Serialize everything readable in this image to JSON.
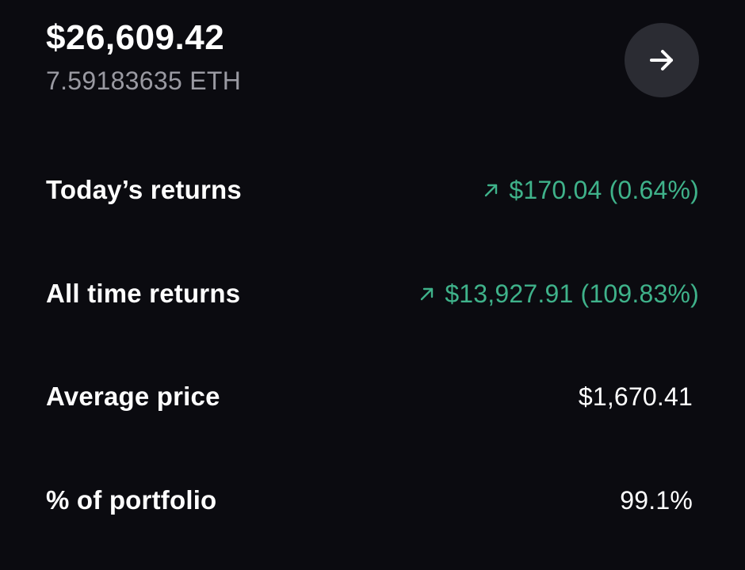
{
  "header": {
    "balance_usd": "$26,609.42",
    "balance_crypto": "7.59183635 ETH",
    "forward_icon": "arrow-right-icon"
  },
  "stats": {
    "today_returns": {
      "label": "Today’s returns",
      "value": "$170.04 (0.64%)",
      "icon": "arrow-up-right-icon"
    },
    "all_time_returns": {
      "label": "All time returns",
      "value": "$13,927.91 (109.83%)",
      "icon": "arrow-up-right-icon"
    },
    "average_price": {
      "label": "Average price",
      "value": "$1,670.41"
    },
    "portfolio_percent": {
      "label": "% of portfolio",
      "value": "99.1%"
    }
  },
  "colors": {
    "background": "#0b0b10",
    "positive": "#3fb28a",
    "muted_text": "#9a9aa2",
    "button_bg": "#2b2c33"
  }
}
